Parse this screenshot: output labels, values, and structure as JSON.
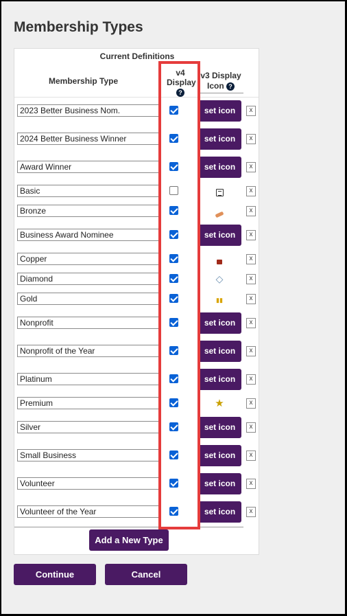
{
  "page": {
    "title": "Membership Types"
  },
  "table": {
    "section_heading": "Current Definitions",
    "col_membership_type": "Membership Type",
    "col_v4_display": "v4 Display",
    "col_v3_display": "v3 Display Icon",
    "help_glyph": "?",
    "set_icon_label": "set icon",
    "delete_glyph": "x",
    "rows": [
      {
        "name": "2023 Better Business Nom.",
        "v4": true,
        "v3": "button"
      },
      {
        "name": "2024 Better Business Winner",
        "v4": true,
        "v3": "button"
      },
      {
        "name": "Award Winner",
        "v4": true,
        "v3": "button"
      },
      {
        "name": "Basic",
        "v4": false,
        "v3": "ledger-icon"
      },
      {
        "name": "Bronze",
        "v4": true,
        "v3": "bronze-bar-icon"
      },
      {
        "name": "Business Award Nominee",
        "v4": true,
        "v3": "button"
      },
      {
        "name": "Copper",
        "v4": true,
        "v3": "copper-block-icon"
      },
      {
        "name": "Diamond",
        "v4": true,
        "v3": "diamond-icon"
      },
      {
        "name": "Gold",
        "v4": true,
        "v3": "gold-bars-icon"
      },
      {
        "name": "Nonprofit",
        "v4": true,
        "v3": "button"
      },
      {
        "name": "Nonprofit of the Year",
        "v4": true,
        "v3": "button"
      },
      {
        "name": "Platinum",
        "v4": true,
        "v3": "button"
      },
      {
        "name": "Premium",
        "v4": true,
        "v3": "star-icon"
      },
      {
        "name": "Silver",
        "v4": true,
        "v3": "button"
      },
      {
        "name": "Small Business",
        "v4": true,
        "v3": "button"
      },
      {
        "name": "Volunteer",
        "v4": true,
        "v3": "button"
      },
      {
        "name": "Volunteer of the Year",
        "v4": true,
        "v3": "button"
      }
    ]
  },
  "buttons": {
    "add_new_type": "Add a New Type",
    "continue": "Continue",
    "cancel": "Cancel"
  },
  "colors": {
    "button_purple": "#4a1a63",
    "highlight_red": "#e53c3c",
    "checkbox_blue": "#0a62d6"
  }
}
